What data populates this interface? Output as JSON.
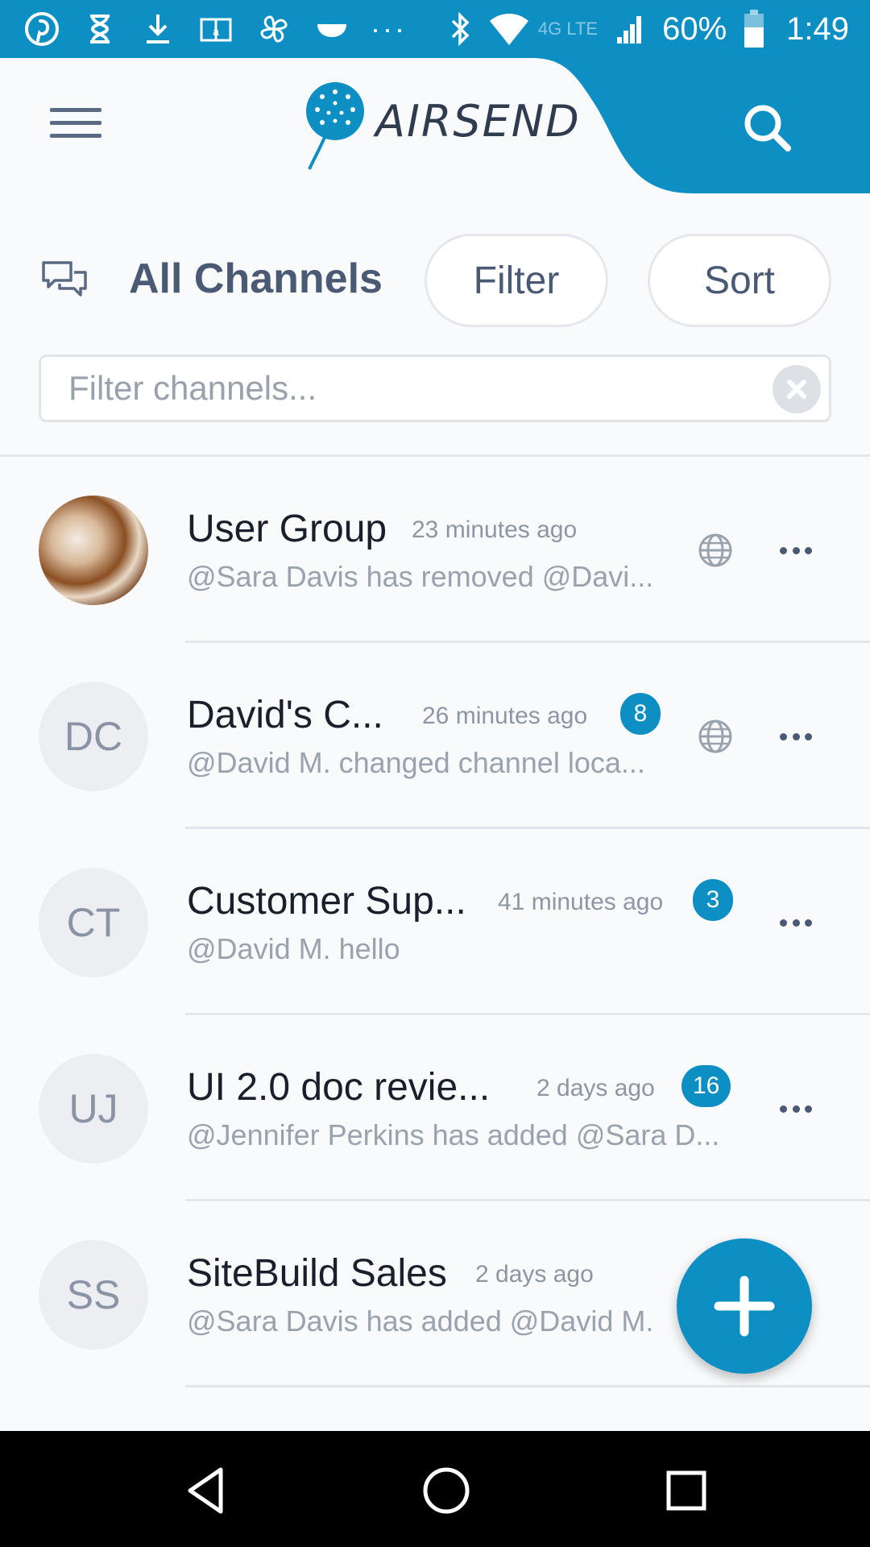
{
  "status_bar": {
    "left_icons": [
      "pinterest-icon",
      "hourglass-icon",
      "download-icon",
      "amazon-kindle-icon",
      "pinwheel-icon",
      "cloud-icon"
    ],
    "more": "···",
    "network": "4G LTE",
    "battery": "60%",
    "time": "1:49"
  },
  "header": {
    "app_name": "AIRSEND",
    "colors": {
      "accent": "#0e8fc4",
      "text": "#4a5974"
    }
  },
  "toolbar": {
    "title": "All Channels",
    "filter_label": "Filter",
    "sort_label": "Sort"
  },
  "search": {
    "placeholder": "Filter channels...",
    "value": ""
  },
  "channels": [
    {
      "initials": "",
      "avatar": "photo",
      "name": "User Group",
      "time": "23 minutes ago",
      "badge": "",
      "message": "@Sara Davis  has removed @Davi...",
      "public": true
    },
    {
      "initials": "DC",
      "avatar": "initials",
      "name": "David's C...",
      "time": "26 minutes ago",
      "badge": "8",
      "message": "@David M. changed channel loca...",
      "public": true
    },
    {
      "initials": "CT",
      "avatar": "initials",
      "name": "Customer Sup...",
      "time": "41 minutes ago",
      "badge": "3",
      "message": "@David M. hello",
      "public": false
    },
    {
      "initials": "UJ",
      "avatar": "initials",
      "name": "UI 2.0 doc revie...",
      "time": "2 days ago",
      "badge": "16",
      "message": "@Jennifer Perkins has added @Sara D...",
      "public": false
    },
    {
      "initials": "SS",
      "avatar": "initials",
      "name": "SiteBuild Sales",
      "time": "2 days ago",
      "badge": "",
      "message": "@Sara Davis has added @David M.",
      "public": false
    }
  ],
  "fab": {
    "icon": "plus-icon"
  },
  "nav": {
    "back": "back-icon",
    "home": "home-icon",
    "recents": "recents-icon"
  }
}
